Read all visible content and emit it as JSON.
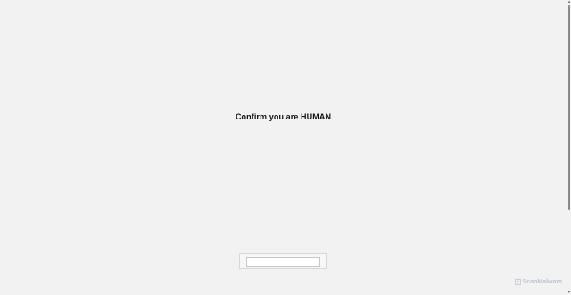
{
  "main": {
    "headline": "Confirm you are HUMAN",
    "captcha_input": {
      "value": "",
      "placeholder": ""
    }
  },
  "watermark": {
    "text": "ScanMalware",
    "icon": "scanmalware-logo-icon"
  },
  "scrollbar": {
    "up_arrow": "▲",
    "down_arrow": "▼"
  },
  "colors": {
    "background": "#f2f2f2",
    "headline": "#111111",
    "watermark": "#b9c3cf",
    "scroll_thumb": "#8a8a8a"
  }
}
